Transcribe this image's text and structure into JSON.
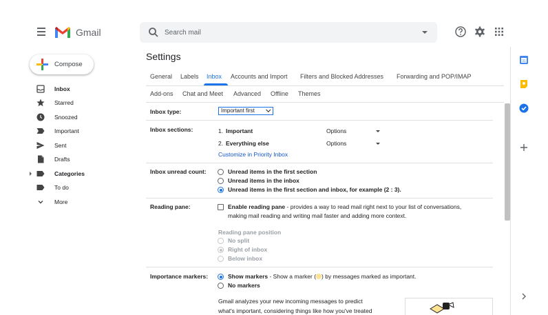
{
  "header": {
    "app_name": "Gmail",
    "search_placeholder": "Search mail"
  },
  "icons": {
    "menu": "hamburger-icon",
    "search": "search-icon",
    "help": "help-icon",
    "settings": "gear-icon",
    "apps": "apps-grid-icon"
  },
  "sidebar": {
    "compose_label": "Compose",
    "items": [
      {
        "label": "Inbox",
        "icon": "inbox-icon",
        "bold": true
      },
      {
        "label": "Starred",
        "icon": "star-icon"
      },
      {
        "label": "Snoozed",
        "icon": "clock-icon"
      },
      {
        "label": "Important",
        "icon": "important-icon"
      },
      {
        "label": "Sent",
        "icon": "send-icon"
      },
      {
        "label": "Drafts",
        "icon": "draft-icon"
      },
      {
        "label": "Categories",
        "icon": "label-icon",
        "bold": true
      },
      {
        "label": "To do",
        "icon": "label-icon"
      },
      {
        "label": "More",
        "icon": "chevron-down-icon"
      }
    ]
  },
  "settings": {
    "title": "Settings",
    "tabs_row1": [
      "General",
      "Labels",
      "Inbox",
      "Accounts and Import",
      "Filters and Blocked Addresses",
      "Forwarding and POP/IMAP"
    ],
    "tabs_row2": [
      "Add-ons",
      "Chat and Meet",
      "Advanced",
      "Offline",
      "Themes"
    ],
    "active_tab": "Inbox",
    "inbox_type": {
      "label": "Inbox type:",
      "selected": "Important first"
    },
    "inbox_sections": {
      "label": "Inbox sections:",
      "section1_num": "1.",
      "section1": "Important",
      "section2_num": "2.",
      "section2": "Everything else",
      "options_label": "Options",
      "customize_link": "Customize in Priority Inbox"
    },
    "unread_count": {
      "label": "Inbox unread count:",
      "options": [
        "Unread items in the first section",
        "Unread items in the inbox",
        "Unread items in the first section and inbox, for example (2 : 3)."
      ],
      "selected_index": 2
    },
    "reading_pane": {
      "label": "Reading pane:",
      "enable_bold": "Enable reading pane",
      "enable_desc_1": " - provides a way to read mail right next to your list of conversations,",
      "enable_desc_2": "making mail reading and writing mail faster and adding more context.",
      "position_heading": "Reading pane position",
      "positions": [
        "No split",
        "Right of inbox",
        "Below inbox"
      ],
      "selected_position_index": 1
    },
    "importance_markers": {
      "label": "Importance markers:",
      "show_bold": "Show markers",
      "show_desc_a": " - Show a marker (",
      "show_desc_b": ") by messages marked as important.",
      "no_markers": "No markers",
      "analysis_1": "Gmail analyzes your new incoming messages to predict",
      "analysis_2": "what's important, considering things like how you've treated"
    }
  },
  "colors": {
    "accent": "#1a73e8",
    "link": "#1155cc",
    "marker": "#fde293"
  }
}
